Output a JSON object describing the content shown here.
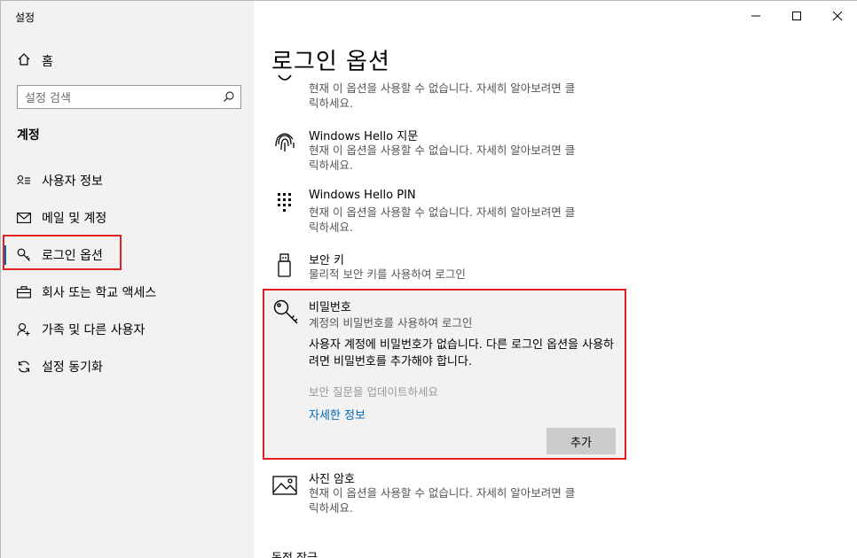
{
  "window": {
    "title": "설정",
    "controls": [
      "minimize-icon",
      "maximize-icon",
      "close-icon"
    ]
  },
  "sidebar": {
    "home_label": "홈",
    "search_placeholder": "설정 검색",
    "section_title": "계정",
    "items": [
      {
        "label": "사용자 정보",
        "icon": "user-info-icon",
        "active": false
      },
      {
        "label": "메일 및 계정",
        "icon": "mail-icon",
        "active": false
      },
      {
        "label": "로그인 옵션",
        "icon": "key-icon",
        "active": true
      },
      {
        "label": "회사 또는 학교 액세스",
        "icon": "briefcase-icon",
        "active": false
      },
      {
        "label": "가족 및 다른 사용자",
        "icon": "add-user-icon",
        "active": false
      },
      {
        "label": "설정 동기화",
        "icon": "sync-icon",
        "active": false
      }
    ]
  },
  "main": {
    "page_title": "로그인 옵션",
    "options": [
      {
        "title": "",
        "desc_line1": "현재 이 옵션을 사용할 수 없습니다. 자세히 알아보려면 클",
        "desc_line2": "릭하세요.",
        "icon": "face-icon"
      },
      {
        "title": "Windows Hello 지문",
        "desc_line1": "현재 이 옵션을 사용할 수 없습니다. 자세히 알아보려면 클",
        "desc_line2": "릭하세요.",
        "icon": "fingerprint-icon"
      },
      {
        "title": "Windows Hello PIN",
        "desc_line1": "현재 이 옵션을 사용할 수 없습니다. 자세히 알아보려면 클",
        "desc_line2": "릭하세요.",
        "icon": "pin-keypad-icon"
      },
      {
        "title": "보안 키",
        "desc_line1": "물리적 보안 키를 사용하여 로그인",
        "desc_line2": "",
        "icon": "usb-key-icon"
      }
    ],
    "password": {
      "title": "비밀번호",
      "subtitle": "계정의 비밀번호를 사용하여 로그인",
      "message": "사용자 계정에 비밀번호가 없습니다. 다른 로그인 옵션을 사용하려면 비밀번호를 추가해야 합니다.",
      "disabled_link": "보안 질문을 업데이트하세요",
      "learn_more": "자세한 정보",
      "add_button": "추가",
      "icon": "password-key-icon"
    },
    "picture_password": {
      "title": "사진 암호",
      "desc_line1": "현재 이 옵션을 사용할 수 없습니다. 자세히 알아보려면 클",
      "desc_line2": "릭하세요.",
      "icon": "picture-icon"
    },
    "bottom_cut_text": "동적 잠금"
  },
  "colors": {
    "accent": "#0067b8",
    "highlight_box": "#e02020",
    "sidebar_bg": "#f2f2f2"
  }
}
